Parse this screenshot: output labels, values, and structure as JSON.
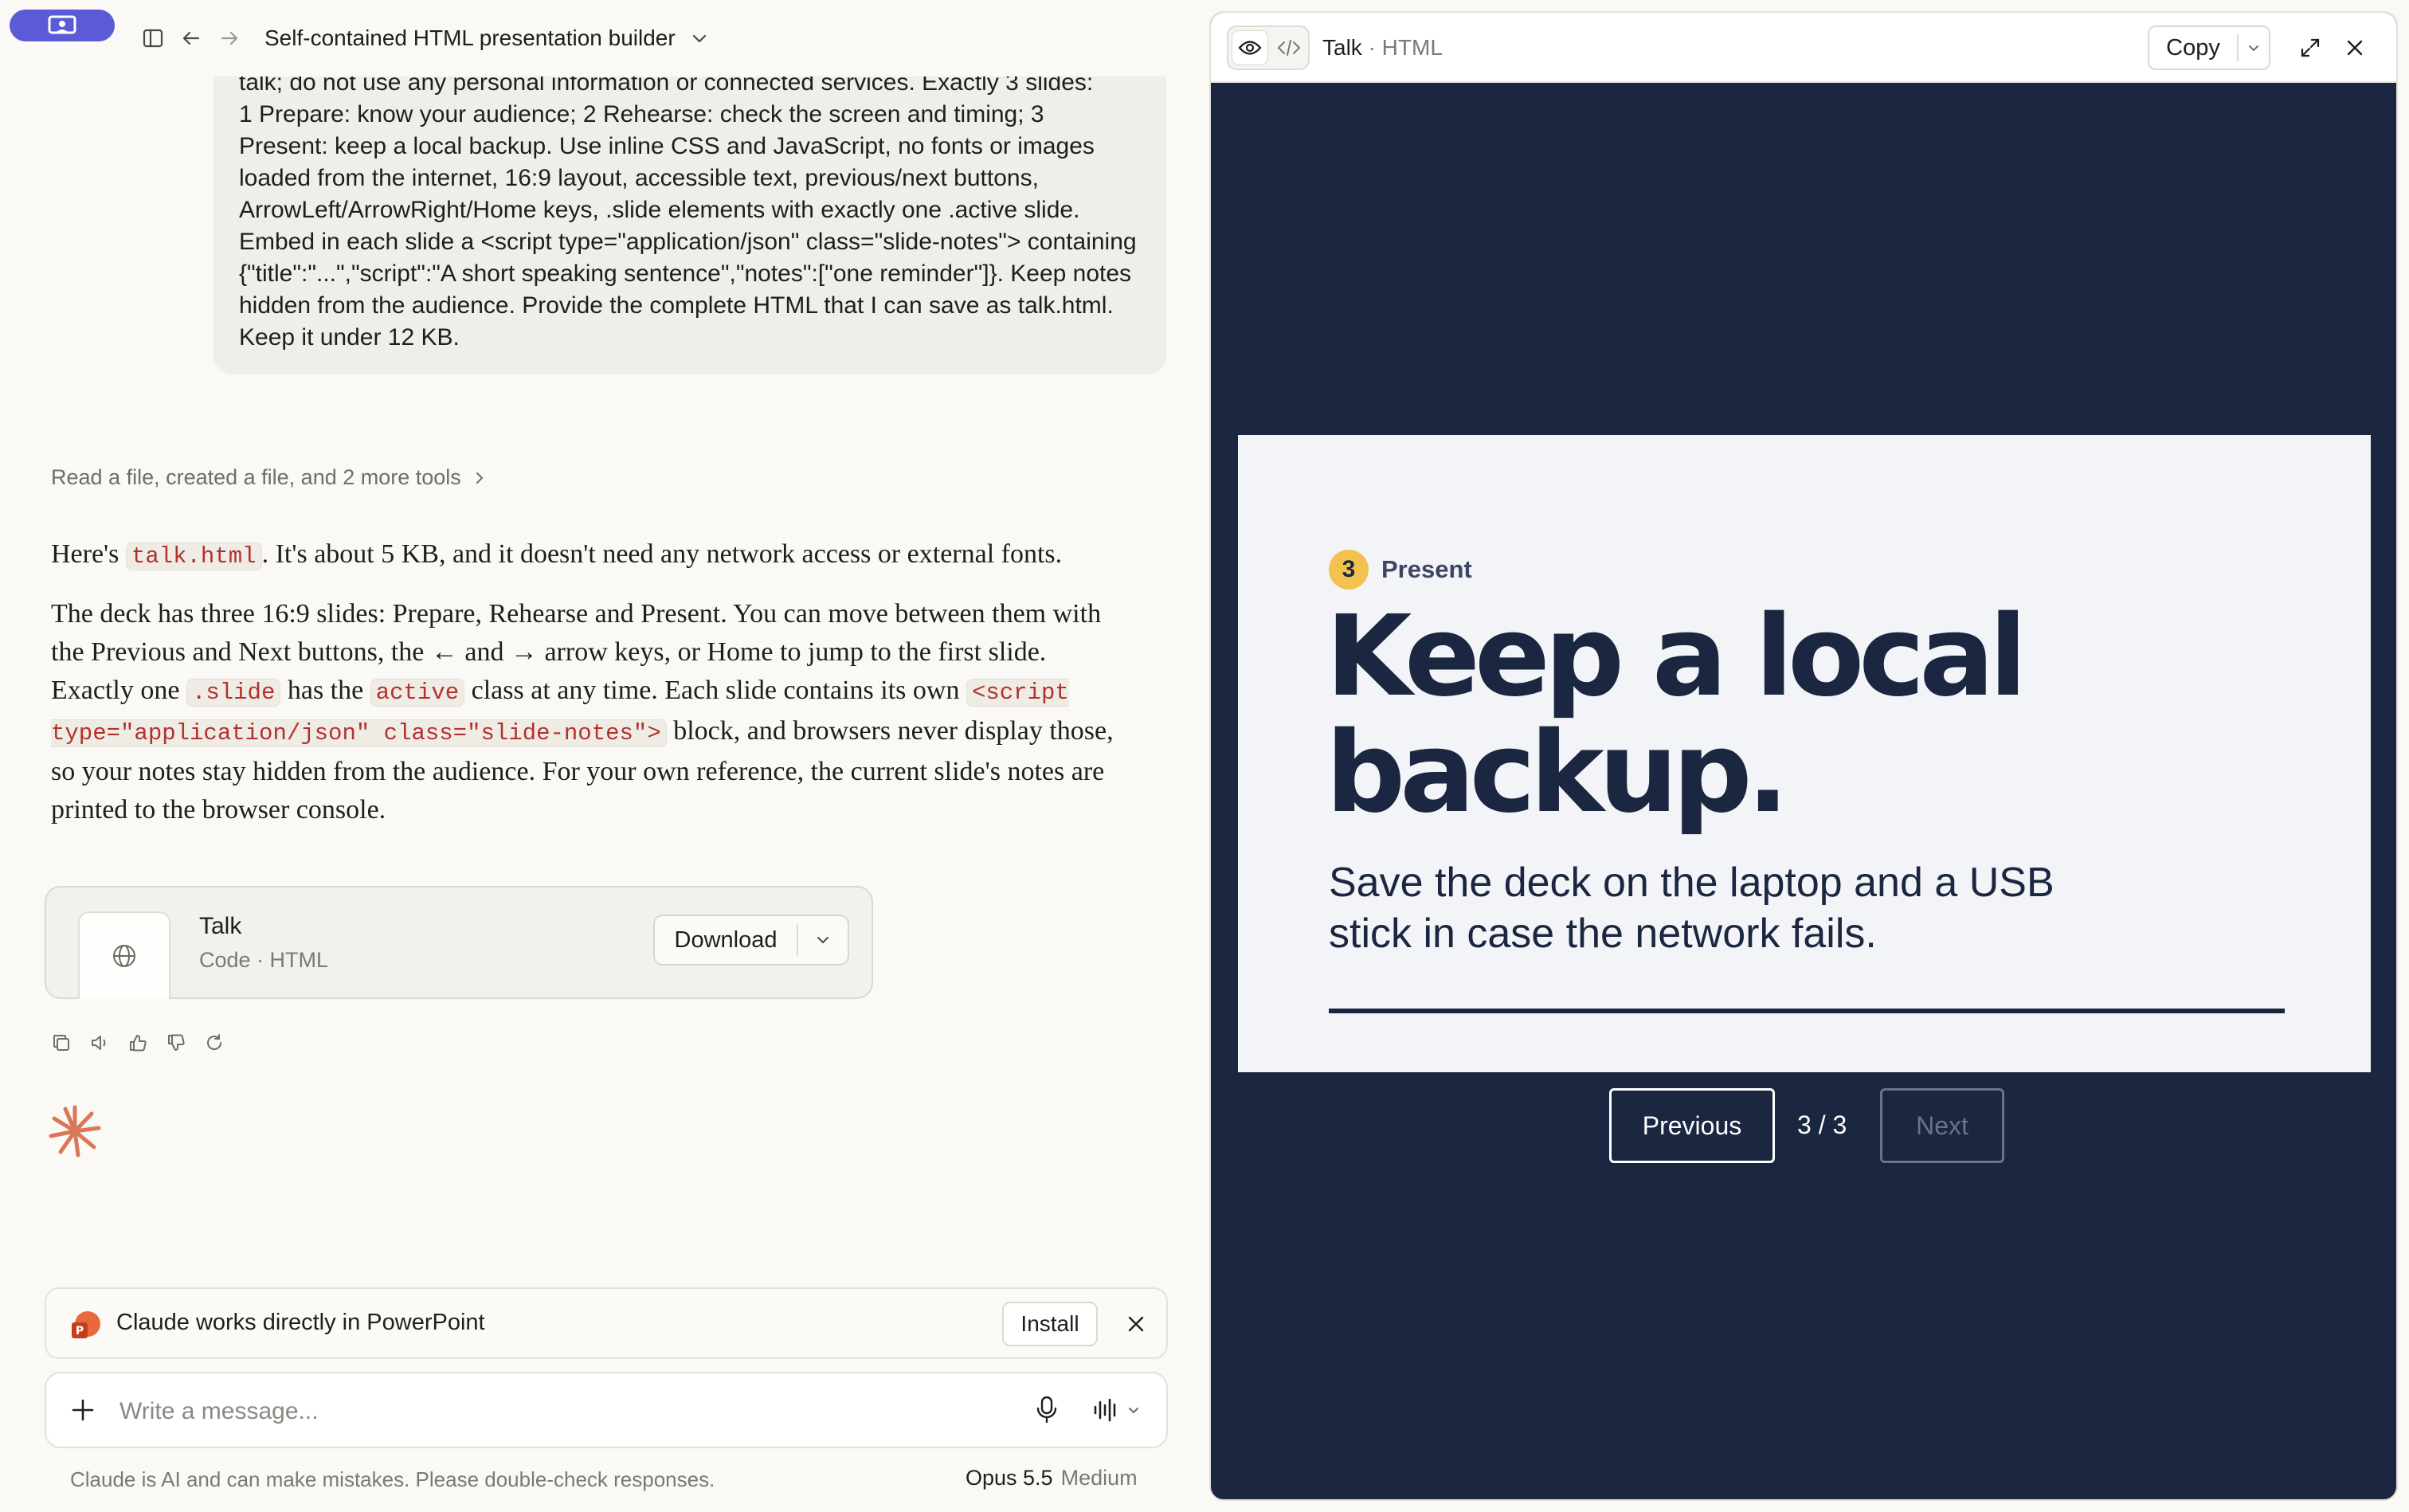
{
  "header": {
    "chat_title": "Self-contained HTML presentation builder"
  },
  "user_message": {
    "text": "talk; do not use any personal information or connected services. Exactly 3 slides:\n1 Prepare: know your audience; 2 Rehearse: check the screen and timing; 3 Present: keep a local backup. Use inline CSS and JavaScript, no fonts or images loaded from the internet, 16:9 layout, accessible text, previous/next buttons, ArrowLeft/ArrowRight/Home keys, .slide elements with exactly one .active slide. Embed in each slide a <script type=\"application/json\" class=\"slide-notes\"> containing {\"title\":\"...\",\"script\":\"A short speaking sentence\",\"notes\":[\"one reminder\"]}. Keep notes hidden from the audience. Provide the complete HTML that I can save as talk.html. Keep it under 12 KB."
  },
  "tools_summary": "Read a file, created a file, and 2 more tools",
  "reply": {
    "p1_a": "Here's ",
    "p1_code": "talk.html",
    "p1_b": ". It's about 5 KB, and it doesn't need any network access or external fonts.",
    "p2_a": "The deck has three 16:9 slides: Prepare, Rehearse and Present. You can move between them with the Previous and Next buttons, the ← and → arrow keys, or Home to jump to the first slide. Exactly one ",
    "p2_code1": ".slide",
    "p2_b": " has the ",
    "p2_code2": "active",
    "p2_c": " class at any time. Each slide contains its own ",
    "p2_code3": "<script type=\"application/json\" class=\"slide-notes\">",
    "p2_d": " block, and browsers never display those, so your notes stay hidden from the audience. For your own reference, the current slide's notes are printed to the browser console."
  },
  "artifact": {
    "name": "Talk",
    "type": "Code · HTML",
    "download_label": "Download"
  },
  "banner": {
    "text": "Claude works directly in PowerPoint",
    "install_label": "Install"
  },
  "composer": {
    "placeholder": "Write a message..."
  },
  "footer": {
    "disclaimer": "Claude is AI and can make mistakes. Please double-check responses.",
    "model": "Opus 5.5",
    "effort": "Medium"
  },
  "panel": {
    "title": "Talk",
    "subtitle": "· HTML",
    "copy_label": "Copy"
  },
  "slide": {
    "number": "3",
    "kicker": "Present",
    "heading": "Keep a local backup.",
    "subtitle": "Save the deck on the laptop and a USB stick in case the network fails."
  },
  "deck_nav": {
    "previous_label": "Previous",
    "counter": "3 / 3",
    "next_label": "Next"
  },
  "colors": {
    "accent": "#5b5bd6",
    "slide_navy": "#1b2640",
    "badge_yellow": "#f2c14e",
    "code_red": "#b4312b"
  }
}
